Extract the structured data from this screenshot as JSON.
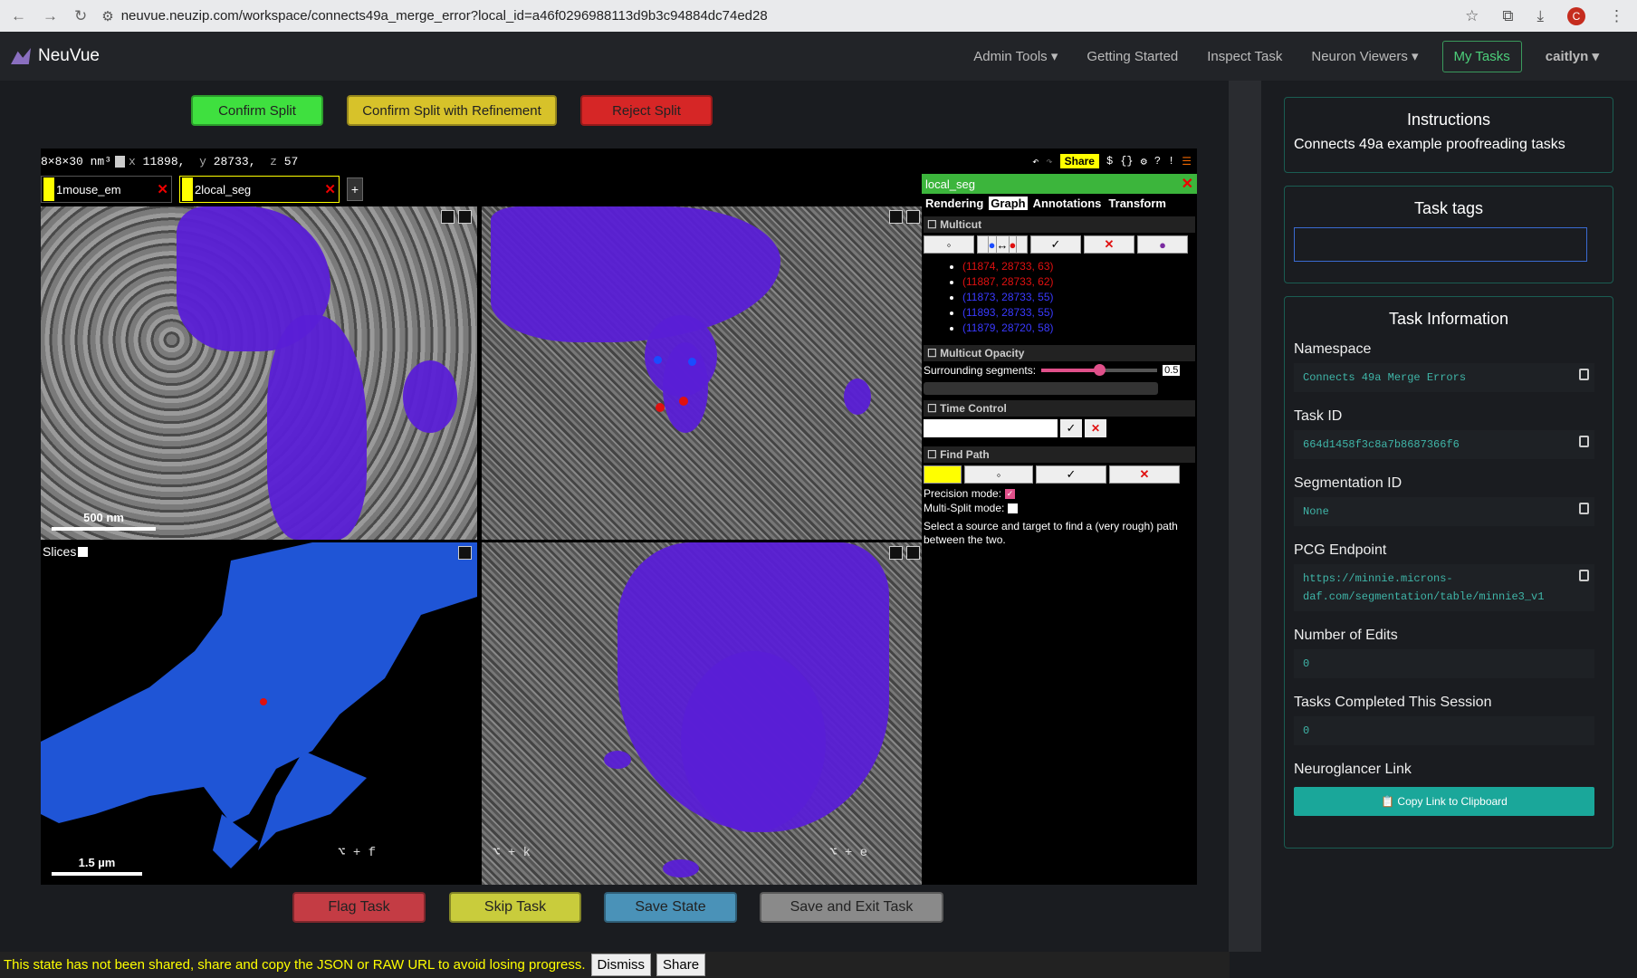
{
  "browser": {
    "url": "neuvue.neuzip.com/workspace/connects49a_merge_error?local_id=a46f0296988113d9b3c94884dc74ed28",
    "avatar_letter": "C"
  },
  "nav": {
    "brand": "NeuVue",
    "admin_tools": "Admin Tools",
    "getting_started": "Getting Started",
    "inspect_task": "Inspect Task",
    "neuron_viewers": "Neuron Viewers",
    "my_tasks": "My Tasks",
    "user": "caitlyn",
    "caret": "▾"
  },
  "actions": {
    "confirm_split": "Confirm Split",
    "confirm_refine": "Confirm Split with Refinement",
    "reject_split": "Reject Split"
  },
  "neuroglancer": {
    "dims": "8×8×30 nm³",
    "coord_x_label": "x",
    "coord_x": "11898,",
    "coord_y_label": "y",
    "coord_y": "28733,",
    "coord_z_label": "z",
    "coord_z": "57",
    "share": "Share",
    "top_icons": [
      "$",
      "{}",
      "⚙",
      "?",
      "!"
    ],
    "layers": [
      {
        "num": "1",
        "name": "mouse_em"
      },
      {
        "num": "2",
        "name": "local_seg"
      }
    ],
    "add_layer": "+",
    "scale_xy": "500 nm",
    "scale_3d": "1.5 µm",
    "slices_label": "Slices"
  },
  "side": {
    "layer_name": "local_seg",
    "tabs": [
      "Rendering",
      "Graph",
      "Annotations",
      "Transform"
    ],
    "multicut_title": "Multicut",
    "points": [
      {
        "text": "(11874, 28733, 63)",
        "color": "#e01010"
      },
      {
        "text": "(11887, 28733, 62)",
        "color": "#e01010"
      },
      {
        "text": "(11873, 28733, 55)",
        "color": "#3a3aff"
      },
      {
        "text": "(11893, 28733, 55)",
        "color": "#3a3aff"
      },
      {
        "text": "(11879, 28720, 58)",
        "color": "#3a3aff"
      }
    ],
    "opacity_title": "Multicut Opacity",
    "surrounding_label": "Surrounding segments:",
    "surrounding_value": "0.5",
    "time_title": "Time Control",
    "findpath_title": "Find Path",
    "precision_label": "Precision mode:",
    "multisplit_label": "Multi-Split mode:",
    "findpath_help": "Select a source and target to find a (very rough) path between the two."
  },
  "instructions": {
    "title": "Instructions",
    "text": "Connects 49a example proofreading tasks"
  },
  "tags": {
    "title": "Task tags"
  },
  "info": {
    "title": "Task Information",
    "namespace_label": "Namespace",
    "namespace": "Connects 49a Merge Errors",
    "taskid_label": "Task ID",
    "taskid": "664d1458f3c8a7b8687366f6",
    "segid_label": "Segmentation ID",
    "segid": "None",
    "pcg_label": "PCG Endpoint",
    "pcg": "https://minnie.microns-daf.com/segmentation/table/minnie3_v1",
    "edits_label": "Number of Edits",
    "edits": "0",
    "completed_label": "Tasks Completed This Session",
    "completed": "0",
    "ng_label": "Neuroglancer Link",
    "copy_link": "📋 Copy Link to Clipboard"
  },
  "bottom": {
    "flag": "Flag Task",
    "flag_kb": "⌥ + f",
    "skip": "Skip Task",
    "skip_kb": "⌥ + k",
    "save": "Save State",
    "save_exit": "Save and Exit Task",
    "save_exit_kb": "⌥ + e"
  },
  "notice": {
    "text": "This state has not been shared, share and copy the JSON or RAW URL to avoid losing progress.",
    "dismiss": "Dismiss",
    "share": "Share"
  }
}
